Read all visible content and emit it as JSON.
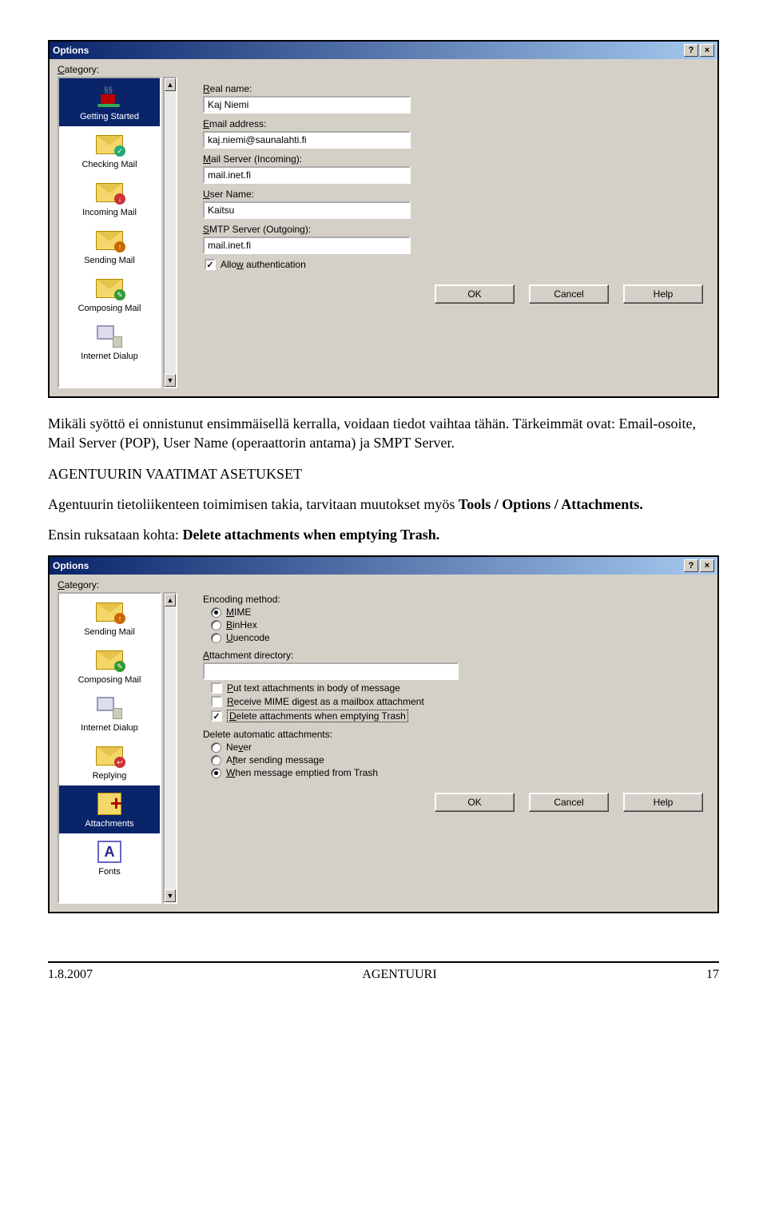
{
  "window1": {
    "title": "Options",
    "help_btn": "?",
    "close_btn": "×",
    "category_label": "Category:",
    "sidebar": {
      "scroll_up": "▲",
      "scroll_down": "▼",
      "items": [
        {
          "label": "Getting Started",
          "icon": "cup",
          "selected": true
        },
        {
          "label": "Checking Mail",
          "icon": "envelope-check"
        },
        {
          "label": "Incoming Mail",
          "icon": "envelope-in"
        },
        {
          "label": "Sending Mail",
          "icon": "envelope-out"
        },
        {
          "label": "Composing Mail",
          "icon": "envelope-compose"
        },
        {
          "label": "Internet Dialup",
          "icon": "computer"
        }
      ]
    },
    "form": {
      "real_name_label": "Real name:",
      "real_name_value": "Kaj Niemi",
      "email_label": "Email address:",
      "email_value": "kaj.niemi@saunalahti.fi",
      "pop_label": "Mail Server (Incoming):",
      "pop_value": "mail.inet.fi",
      "user_label": "User Name:",
      "user_value": "Kaitsu",
      "smtp_label": "SMTP Server (Outgoing):",
      "smtp_value": "mail.inet.fi",
      "allow_auth_label": "Allow authentication",
      "allow_auth_checked": true
    },
    "buttons": {
      "ok": "OK",
      "cancel": "Cancel",
      "help": "Help"
    }
  },
  "para1": "Mikäli syöttö ei onnistunut ensimmäisellä kerralla, voidaan tiedot vaihtaa tähän. Tärkeimmät ovat: Email-osoite, Mail Server (POP), User Name (operaattorin antama) ja SMPT Server.",
  "heading_agent": "AGENTUURIN VAATIMAT ASETUKSET",
  "para2_a": "Agentuurin tietoliikenteen toimimisen takia, tarvitaan muutokset myös ",
  "para2_b": "Tools / Options / Attachments.",
  "para3_a": "Ensin ruksataan kohta: ",
  "para3_b": "Delete attachments when emptying Trash.",
  "window2": {
    "title": "Options",
    "help_btn": "?",
    "close_btn": "×",
    "category_label": "Category:",
    "sidebar": {
      "scroll_up": "▲",
      "scroll_down": "▼",
      "items": [
        {
          "label": "Sending Mail",
          "icon": "envelope-out"
        },
        {
          "label": "Composing Mail",
          "icon": "envelope-compose"
        },
        {
          "label": "Internet Dialup",
          "icon": "computer"
        },
        {
          "label": "Replying",
          "icon": "envelope-reply"
        },
        {
          "label": "Attachments",
          "icon": "file-attach",
          "selected": true
        },
        {
          "label": "Fonts",
          "icon": "font-a"
        }
      ]
    },
    "form": {
      "encoding_label": "Encoding method:",
      "enc_mime": "MIME",
      "enc_binhex": "BinHex",
      "enc_uuencode": "Uuencode",
      "enc_selected": "MIME",
      "attach_dir_label": "Attachment directory:",
      "attach_dir_value": "",
      "chk_put_body": "Put text attachments in body of message",
      "chk_put_body_checked": false,
      "chk_receive_mime": "Receive MIME digest as a mailbox attachment",
      "chk_receive_mime_checked": false,
      "chk_delete": "Delete attachments when emptying Trash",
      "chk_delete_checked": true,
      "del_auto_label": "Delete automatic attachments:",
      "del_never": "Never",
      "del_after": "After sending message",
      "del_when": "When message emptied from Trash",
      "del_selected": "When message emptied from Trash"
    },
    "buttons": {
      "ok": "OK",
      "cancel": "Cancel",
      "help": "Help"
    }
  },
  "footer": {
    "date": "1.8.2007",
    "title": "AGENTUURI",
    "page": "17"
  }
}
